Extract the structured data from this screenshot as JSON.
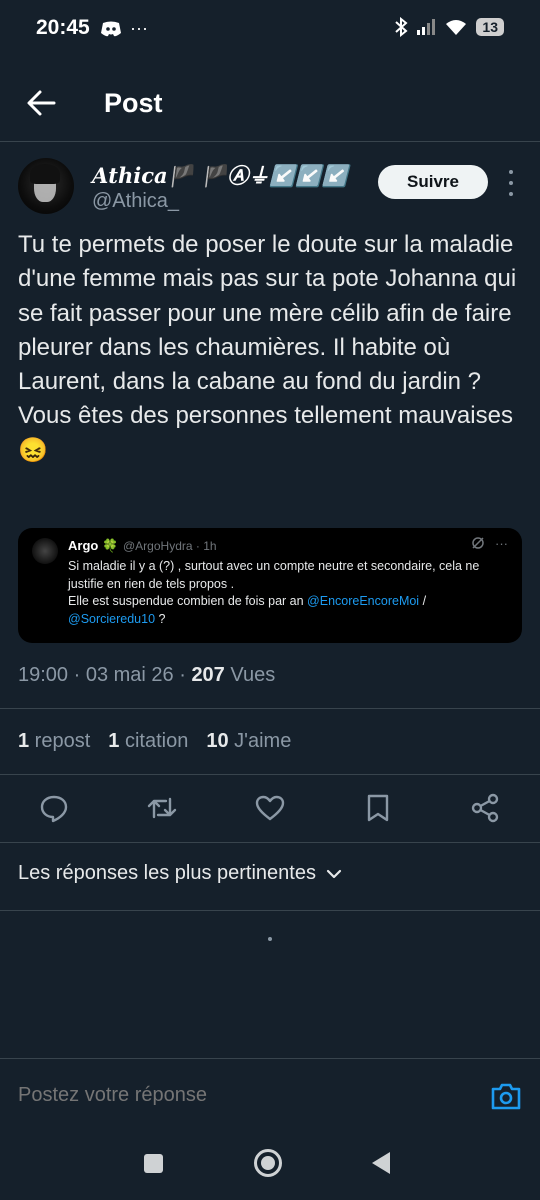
{
  "status_bar": {
    "time": "20:45",
    "extra": "···",
    "battery": "13"
  },
  "header": {
    "title": "Post"
  },
  "author": {
    "display_name": "𝑨𝒕𝒉𝒊𝒄𝒂🏴 🏴Ⓐ⏚↙️↙️↙️",
    "handle": "@Athica_"
  },
  "follow_label": "Suivre",
  "tweet_text": "Tu te permets de poser le doute sur la maladie d'une femme mais pas sur ta pote Johanna qui se fait passer pour une mère célib afin de faire pleurer dans les chaumières. Il habite où Laurent, dans la cabane au fond du jardin ?\nVous êtes des personnes tellement mauvaises 😖",
  "quote": {
    "name": "Argo 🍀",
    "handle": "@ArgoHydra · 1h",
    "text_line1": "Si maladie il y a (?) , surtout avec un compte neutre et secondaire, cela ne justifie en rien de tels propos .",
    "text_line2": "Elle est suspendue combien de fois par an ",
    "mention1": "@EncoreEncoreMoi",
    "sep": " /",
    "mention2": "@Sorcieredu10",
    "tail": " ?"
  },
  "meta": {
    "time_date": "19:00 · 03 mai 26 · ",
    "views_count": "207",
    "views_label": " Vues"
  },
  "stats": {
    "reposts_count": "1",
    "reposts_label": " repost",
    "quotes_count": "1",
    "quotes_label": " citation",
    "likes_count": "10",
    "likes_label": " J'aime"
  },
  "sort_label": "Les réponses les plus pertinentes",
  "reply_placeholder": "Postez votre réponse",
  "colors": {
    "background": "#15202b",
    "accent": "#1d9bf0",
    "divider": "#38444d",
    "muted": "#8b98a5"
  },
  "icons": [
    "back-arrow-icon",
    "reply-icon",
    "repost-icon",
    "like-icon",
    "bookmark-icon",
    "share-icon",
    "chevron-down-icon",
    "camera-icon"
  ]
}
